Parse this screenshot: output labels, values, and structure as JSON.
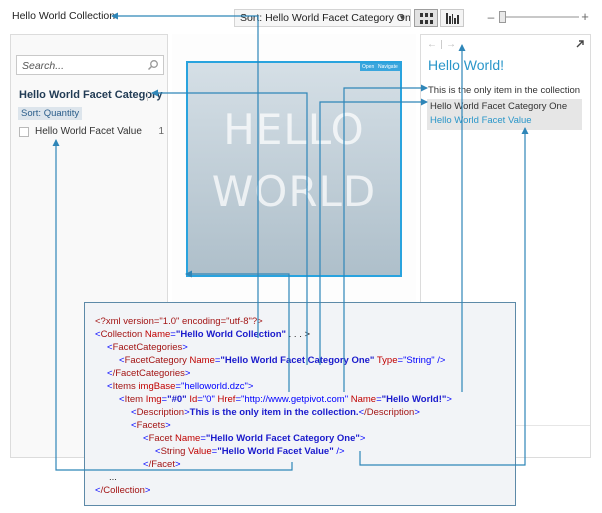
{
  "toolbar": {
    "collection_title": "Hello World Collection",
    "sort_dropdown": "Sort: Hello World Facet Category One",
    "view_grid": "grid-view-icon",
    "view_graph": "graph-view-icon",
    "zoom_minus": "–",
    "zoom_plus": "+",
    "zoom_level": 0
  },
  "filter_pane": {
    "search_placeholder": "Search...",
    "facet_category": "Hello World Facet Category",
    "sort_label": "Sort: Quantity",
    "facet_value": {
      "label": "Hello World Facet Value",
      "count": "1"
    }
  },
  "card": {
    "line1": "HELLO",
    "line2": "WORLD",
    "open_button": "Open",
    "navigate_button": "Navigate"
  },
  "details_pane": {
    "back_arrow": "←",
    "forward_arrow": "→",
    "item_title": "Hello World!",
    "description": "This is the only item in the collection",
    "facet_name": "Hello World Facet Category One",
    "facet_value": "Hello World Facet Value"
  },
  "xml": {
    "l1": {
      "a": "<?xml version=\"1.0\" encoding=\"utf-8\"?>"
    },
    "l2": {
      "tag": "Collection",
      "attr": "Name",
      "val": "\"Hello World Collection\"",
      "rest": " . . . >"
    },
    "l3": {
      "tag": "FacetCategories"
    },
    "l4": {
      "tag": "FacetCategory",
      "attr1": "Name",
      "val1": "\"Hello World Facet Category One\"",
      "attr2": "Type",
      "val2": "\"String\""
    },
    "l5": {
      "tag": "/FacetCategories"
    },
    "l6": {
      "tag": "Items",
      "attr": "imgBase",
      "val": "\"helloworld.dzc\""
    },
    "l7": {
      "tag": "Item",
      "a1": "Img",
      "v1": "\"#0\"",
      "a2": "Id",
      "v2": "\"0\"",
      "a3": "Href",
      "v3": "\"http://www.getpivot.com\"",
      "a4": "Name",
      "v4": "\"Hello World!\""
    },
    "l8": {
      "tag": "Description",
      "text": "This is the only item in the collection.",
      "close": "/Description"
    },
    "l9": {
      "tag": "Facets"
    },
    "l10": {
      "tag": "Facet",
      "attr": "Name",
      "val": "\"Hello World Facet Category One\""
    },
    "l11": {
      "tag": "String",
      "attr": "Value",
      "val": "\"Hello World Facet Value\""
    },
    "l12": {
      "tag": "/Facet"
    },
    "l13": {
      "a": "..."
    },
    "l14": {
      "tag": "/Collection"
    }
  }
}
